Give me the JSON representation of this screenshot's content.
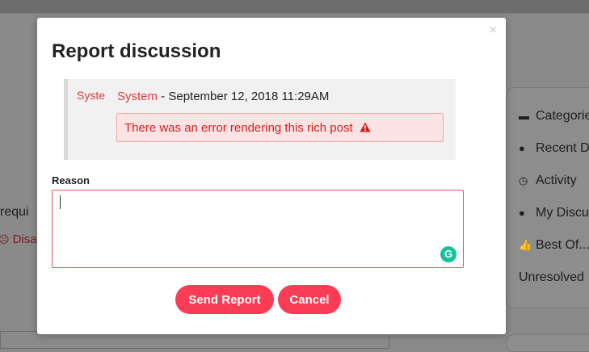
{
  "background": {
    "main_text": "requi",
    "dislike_label": "Disa",
    "sidebar_items": [
      {
        "label": "Categorie",
        "icon": "folder-icon"
      },
      {
        "label": "Recent D",
        "icon": "comments-icon"
      },
      {
        "label": "Activity",
        "icon": "clock-icon"
      },
      {
        "label": "My Discu",
        "icon": "comment-icon"
      },
      {
        "label": "Best Of...",
        "icon": "thumbs-up-icon"
      },
      {
        "label": "Unresolved",
        "icon": ""
      }
    ]
  },
  "modal": {
    "title": "Report discussion",
    "close_glyph": "×",
    "quote": {
      "avatar_alt": "System",
      "author": "System",
      "separator": " - ",
      "date": "September 12, 2018 11:29AM",
      "error_text": "There was an error rendering this rich post"
    },
    "reason_label": "Reason",
    "reason_value": "",
    "grammarly_glyph": "G",
    "send_label": "Send Report",
    "cancel_label": "Cancel"
  },
  "colors": {
    "accent": "#fb3c55",
    "author": "#e03a3a",
    "error_text": "#d11f1f",
    "error_bg": "#fbe3e3",
    "overlay": "#8a8a8a"
  }
}
